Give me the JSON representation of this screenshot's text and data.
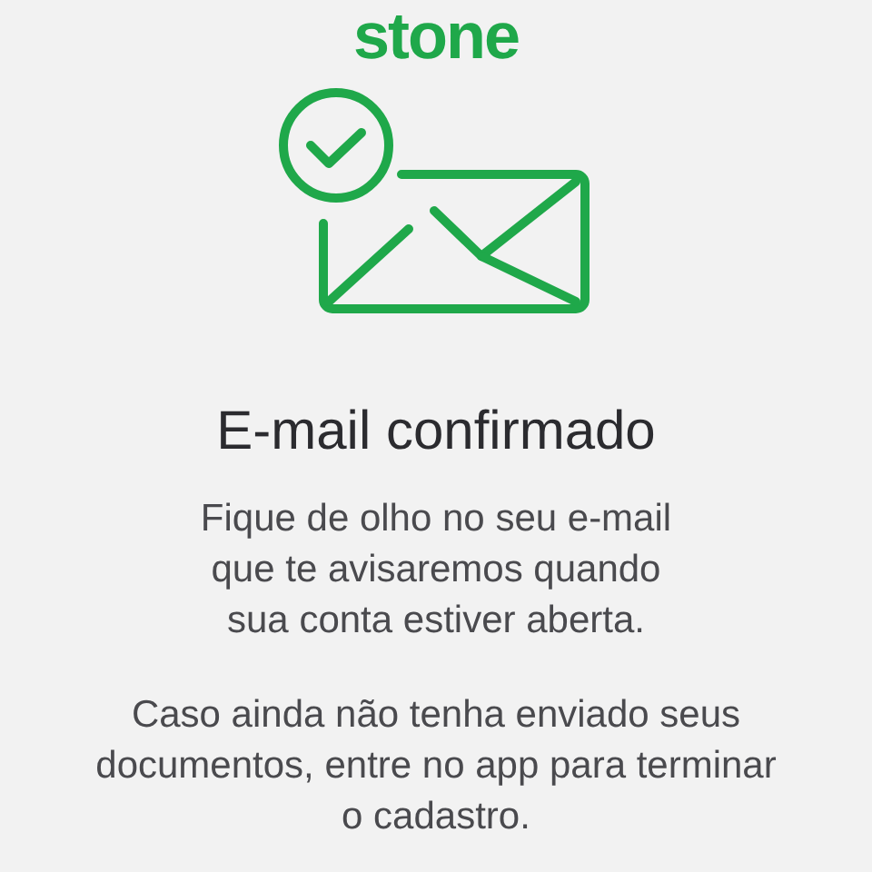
{
  "logo": "stone",
  "title": "E-mail confirmado",
  "paragraphs": [
    {
      "lines": [
        "Fique de olho no seu e-mail",
        "que te avisaremos quando",
        "sua conta estiver aberta."
      ]
    },
    {
      "lines": [
        "Caso ainda não tenha enviado seus",
        "documentos, entre no app para terminar",
        "o cadastro."
      ]
    }
  ]
}
